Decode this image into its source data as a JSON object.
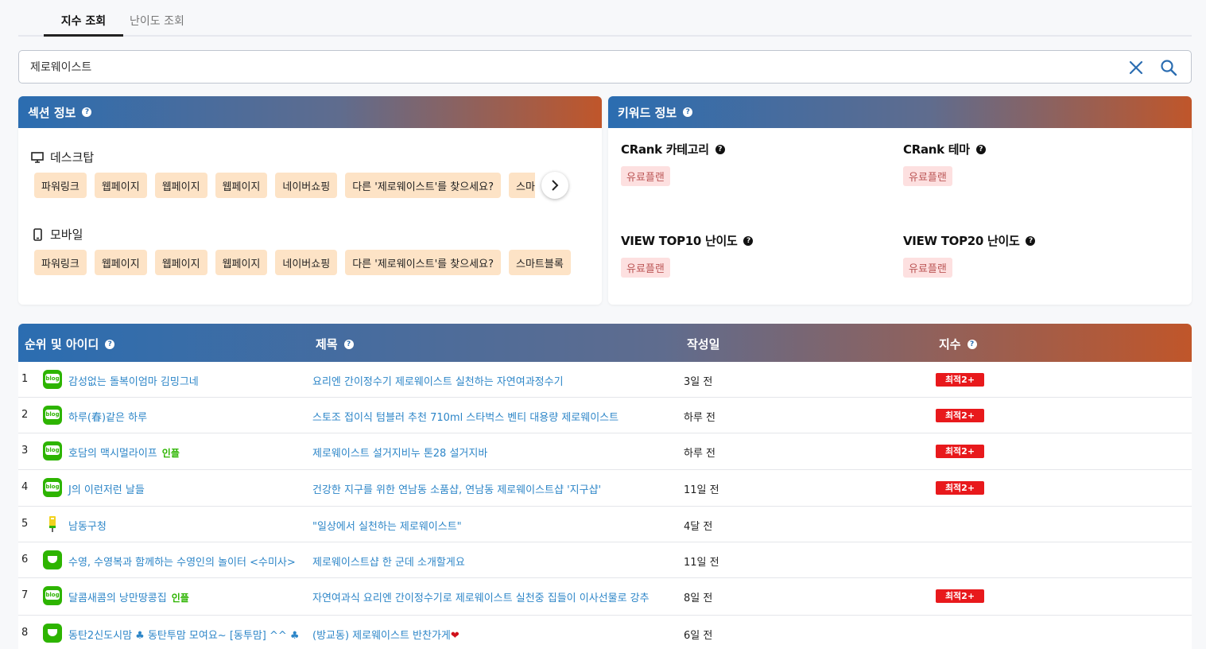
{
  "tabs": {
    "active": "지수 조회",
    "inactive": "난이도 조회"
  },
  "search": {
    "value": "제로웨이스트"
  },
  "section": {
    "title": "섹션 정보",
    "desktop": {
      "label": "데스크탑",
      "chips": [
        "파워링크",
        "웹페이지",
        "웹페이지",
        "웹페이지",
        "네이버쇼핑",
        "다른 '제로웨이스트'를 찾으세요?",
        "스마트블록"
      ]
    },
    "mobile": {
      "label": "모바일",
      "chips": [
        "파워링크",
        "웹페이지",
        "웹페이지",
        "웹페이지",
        "네이버쇼핑",
        "다른 '제로웨이스트'를 찾으세요?",
        "스마트블록"
      ]
    }
  },
  "keyword": {
    "title": "키워드 정보",
    "crank_category": "CRank 카테고리",
    "crank_theme": "CRank 테마",
    "view_top10": "VIEW TOP10 난이도",
    "view_top20": "VIEW TOP20 난이도",
    "paid": "유료플랜"
  },
  "table": {
    "headers": {
      "rank": "순위 및 아이디",
      "title": "제목",
      "date": "작성일",
      "index": "지수"
    },
    "rows": [
      {
        "rank": "1",
        "icon": "blog",
        "name": "감성없는 돌복이엄마 김밍그네",
        "influencer": "",
        "title": "요리엔 간이정수기 제로웨이스트 실천하는 자연여과정수기",
        "date": "3일 전",
        "badge": "최적2+"
      },
      {
        "rank": "2",
        "icon": "blog",
        "name": "하루(春)같은 하루",
        "influencer": "",
        "title": "스토조 접이식 텀블러 추천 710ml 스타벅스 벤티 대용량 제로웨이스트",
        "date": "하루 전",
        "badge": "최적2+"
      },
      {
        "rank": "3",
        "icon": "blog",
        "name": "호담의 맥시멀라이프",
        "influencer": "인플",
        "title": "제로웨이스트 설거지비누 톤28 설거지바",
        "date": "하루 전",
        "badge": "최적2+"
      },
      {
        "rank": "4",
        "icon": "blog",
        "name": "J의 이런저런 날들",
        "influencer": "",
        "title": "건강한 지구를 위한 연남동 소품샵, 연남동 제로웨이스트샵 '지구샵'",
        "date": "11일 전",
        "badge": "최적2+"
      },
      {
        "rank": "5",
        "icon": "post",
        "name": "남동구청",
        "influencer": "",
        "title": "\"일상에서 실천하는 제로웨이스트\"",
        "date": "4달 전",
        "badge": ""
      },
      {
        "rank": "6",
        "icon": "cafe",
        "name": "수영, 수영복과 함께하는 수영인의 놀이터 <수미사>",
        "influencer": "",
        "title": "제로웨이스트샵 한 군데 소개할게요",
        "date": "11일 전",
        "badge": ""
      },
      {
        "rank": "7",
        "icon": "blog",
        "name": "달콤새콤의 낭만땅콩집",
        "influencer": "인플",
        "title": "자연여과식 요리엔 간이정수기로 제로웨이스트 실천중 집들이 이사선물로 강추",
        "date": "8일 전",
        "badge": "최적2+"
      },
      {
        "rank": "8",
        "icon": "cafe",
        "name": "동탄2신도시맘 ♣ 동탄투맘 모여요~ [동투맘] ^^ ♣",
        "influencer": "",
        "title": "(방교동) 제로웨이스트 반찬가게",
        "date": "6일 전",
        "badge": ""
      }
    ]
  }
}
